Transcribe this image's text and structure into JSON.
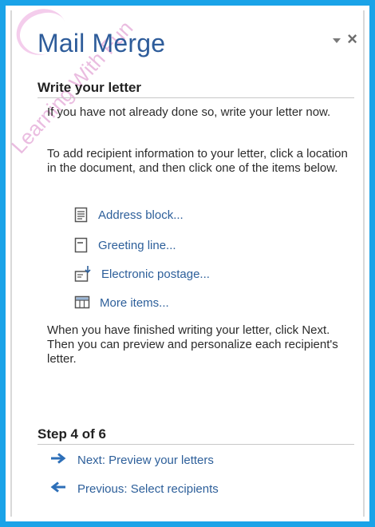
{
  "pane": {
    "title": "Mail Merge",
    "watermark": "Learning With Fun"
  },
  "write_section": {
    "heading": "Write your letter",
    "para1": "If you have not already done so, write your letter now.",
    "para2": "To add recipient information to your letter, click a location in the document, and then click one of the items below.",
    "items": [
      {
        "label": "Address block...",
        "icon": "address-block-icon"
      },
      {
        "label": "Greeting line...",
        "icon": "greeting-line-icon"
      },
      {
        "label": "Electronic postage...",
        "icon": "electronic-postage-icon"
      },
      {
        "label": "More items...",
        "icon": "more-items-icon"
      }
    ],
    "para3": "When you have finished writing your letter, click Next. Then you can preview and personalize each recipient's letter."
  },
  "step": {
    "heading": "Step 4 of 6",
    "next_label": "Next: Preview your letters",
    "previous_label": "Previous: Select recipients"
  },
  "colors": {
    "frame": "#1aa3e8",
    "title": "#2e5c9a",
    "link": "#2d5f9a"
  }
}
